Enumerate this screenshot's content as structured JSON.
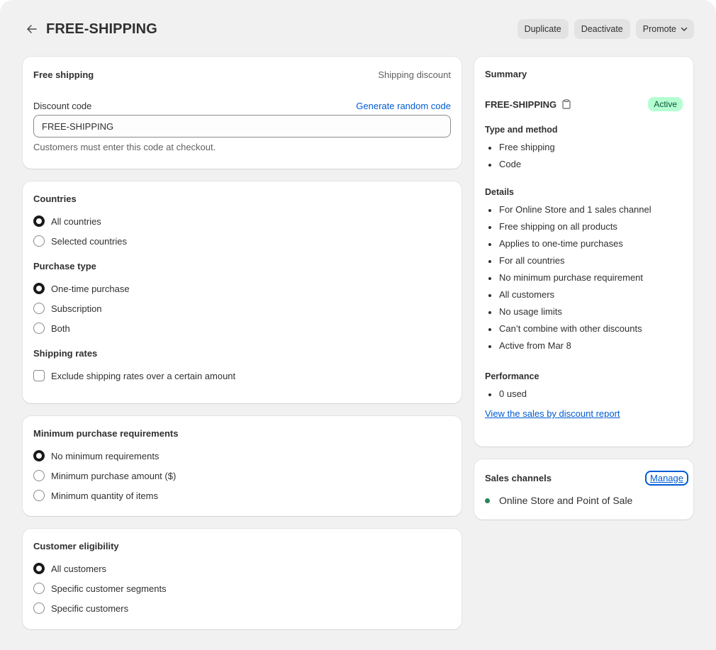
{
  "header": {
    "title": "FREE-SHIPPING",
    "actions": {
      "duplicate": "Duplicate",
      "deactivate": "Deactivate",
      "promote": "Promote"
    }
  },
  "discount_card": {
    "title": "Free shipping",
    "type_label": "Shipping discount",
    "code_label": "Discount code",
    "generate_link": "Generate random code",
    "code_value": "FREE-SHIPPING",
    "help_text": "Customers must enter this code at checkout."
  },
  "countries_card": {
    "countries": {
      "title": "Countries",
      "options": [
        {
          "label": "All countries",
          "selected": true
        },
        {
          "label": "Selected countries",
          "selected": false
        }
      ]
    },
    "purchase_type": {
      "title": "Purchase type",
      "options": [
        {
          "label": "One-time purchase",
          "selected": true
        },
        {
          "label": "Subscription",
          "selected": false
        },
        {
          "label": "Both",
          "selected": false
        }
      ]
    },
    "shipping_rates": {
      "title": "Shipping rates",
      "checkbox_label": "Exclude shipping rates over a certain amount",
      "checked": false
    }
  },
  "minimum_card": {
    "title": "Minimum purchase requirements",
    "options": [
      {
        "label": "No minimum requirements",
        "selected": true
      },
      {
        "label": "Minimum purchase amount ($)",
        "selected": false
      },
      {
        "label": "Minimum quantity of items",
        "selected": false
      }
    ]
  },
  "eligibility_card": {
    "title": "Customer eligibility",
    "options": [
      {
        "label": "All customers",
        "selected": true
      },
      {
        "label": "Specific customer segments",
        "selected": false
      },
      {
        "label": "Specific customers",
        "selected": false
      }
    ]
  },
  "summary": {
    "title": "Summary",
    "code": "FREE-SHIPPING",
    "status": "Active",
    "type_title": "Type and method",
    "type_items": [
      "Free shipping",
      "Code"
    ],
    "details_title": "Details",
    "details_items": [
      "For Online Store and 1 sales channel",
      "Free shipping on all products",
      "Applies to one-time purchases",
      "For all countries",
      "No minimum purchase requirement",
      "All customers",
      "No usage limits",
      "Can’t combine with other discounts",
      "Active from Mar 8"
    ],
    "performance_title": "Performance",
    "performance_items": [
      "0 used"
    ],
    "report_link": "View the sales by discount report"
  },
  "sales_channels": {
    "title": "Sales channels",
    "manage": "Manage",
    "channel": "Online Store and Point of Sale"
  },
  "colors": {
    "link": "#005bd3",
    "badge_bg": "#b4fed2",
    "badge_text": "#0c5132",
    "channel_dot": "#29845a"
  }
}
